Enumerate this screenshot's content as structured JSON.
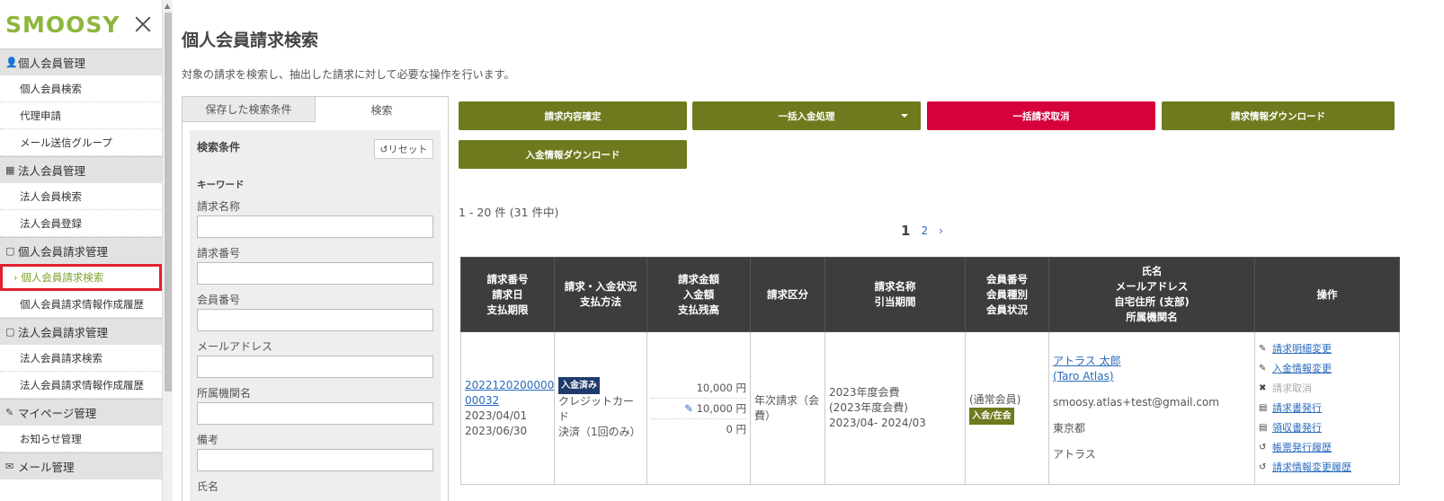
{
  "sidebar": {
    "logo": "SMOOSY",
    "sections": [
      {
        "label": "個人会員管理",
        "icon": "user-icon",
        "glyph": "👤",
        "items": [
          "個人会員検索",
          "代理申請",
          "メール送信グループ"
        ]
      },
      {
        "label": "法人会員管理",
        "icon": "building-icon",
        "glyph": "▦",
        "items": [
          "法人会員検索",
          "法人会員登録"
        ]
      },
      {
        "label": "個人会員請求管理",
        "icon": "document-icon",
        "glyph": "▢",
        "items": [
          "› 個人会員請求検索",
          "個人会員請求情報作成履歴"
        ]
      },
      {
        "label": "法人会員請求管理",
        "icon": "document-icon",
        "glyph": "▢",
        "items": [
          "法人会員請求検索",
          "法人会員請求情報作成履歴"
        ]
      },
      {
        "label": "マイページ管理",
        "icon": "pen-icon",
        "glyph": "✎",
        "items": [
          "お知らせ管理"
        ]
      },
      {
        "label": "メール管理",
        "icon": "mail-icon",
        "glyph": "✉",
        "items": []
      }
    ]
  },
  "main": {
    "title": "個人会員請求検索",
    "description": "対象の請求を検索し、抽出した請求に対して必要な操作を行います。",
    "tabs": [
      "保存した検索条件",
      "検索"
    ],
    "search": {
      "title": "検索条件",
      "reset": "リセット",
      "keyword_label": "キーワード",
      "fields": [
        "請求名称",
        "請求番号",
        "会員番号",
        "メールアドレス",
        "所属機関名",
        "備考",
        "氏名"
      ]
    },
    "buttons": {
      "confirm": "請求内容確定",
      "bulk_payment": "一括入金処理",
      "bulk_cancel": "一括請求取消",
      "download_billing": "請求情報ダウンロード",
      "download_payment": "入金情報ダウンロード"
    },
    "result_count": "1 - 20 件 (31 件中)",
    "pager": {
      "current": "1",
      "next_page": "2",
      "next": "›"
    },
    "table": {
      "headers": [
        [
          "請求番号",
          "請求日",
          "支払期限"
        ],
        [
          "請求・入金状況",
          "支払方法"
        ],
        [
          "請求金額",
          "入金額",
          "支払残高"
        ],
        [
          "請求区分"
        ],
        [
          "請求名称",
          "引当期間"
        ],
        [
          "会員番号",
          "会員種別",
          "会員状況"
        ],
        [
          "氏名",
          "メールアドレス",
          "自宅住所 (支部)",
          "所属機関名"
        ],
        [
          "操作"
        ]
      ],
      "row": {
        "invoice_no_1": "2022120200000",
        "invoice_no_2": "00032",
        "invoice_date": "2023/04/01",
        "due_date": "2023/06/30",
        "status_badge": "入金済み",
        "method_1": "クレジットカード",
        "method_2": "決済（1回のみ）",
        "amount": "10,000 円",
        "paid": "10,000 円",
        "balance": "0 円",
        "category": "年次請求（会費）",
        "name_1": "2023年度会費",
        "name_2": "(2023年度会費)",
        "period": "2023/04- 2024/03",
        "member_type": "(通常会員)",
        "member_status": "入会/在会",
        "person_name": "アトラス 太郎",
        "person_name_en": "(Taro Atlas)",
        "email": "smoosy.atlas+test@gmail.com",
        "address": "東京都",
        "org": "アトラス",
        "ops": [
          {
            "label": "請求明細変更",
            "icon": "pencil-icon",
            "glyph": "✎",
            "disabled": false
          },
          {
            "label": "入金情報変更",
            "icon": "pencil-icon",
            "glyph": "✎",
            "disabled": false
          },
          {
            "label": "請求取消",
            "icon": "cross-icon",
            "glyph": "✖",
            "disabled": true
          },
          {
            "label": "請求書発行",
            "icon": "document-icon",
            "glyph": "▤",
            "disabled": false
          },
          {
            "label": "領収書発行",
            "icon": "document-icon",
            "glyph": "▤",
            "disabled": false
          },
          {
            "label": "帳票発行履歴",
            "icon": "history-icon",
            "glyph": "↺",
            "disabled": false
          },
          {
            "label": "請求情報変更履歴",
            "icon": "history-icon",
            "glyph": "↺",
            "disabled": false
          }
        ]
      }
    }
  }
}
